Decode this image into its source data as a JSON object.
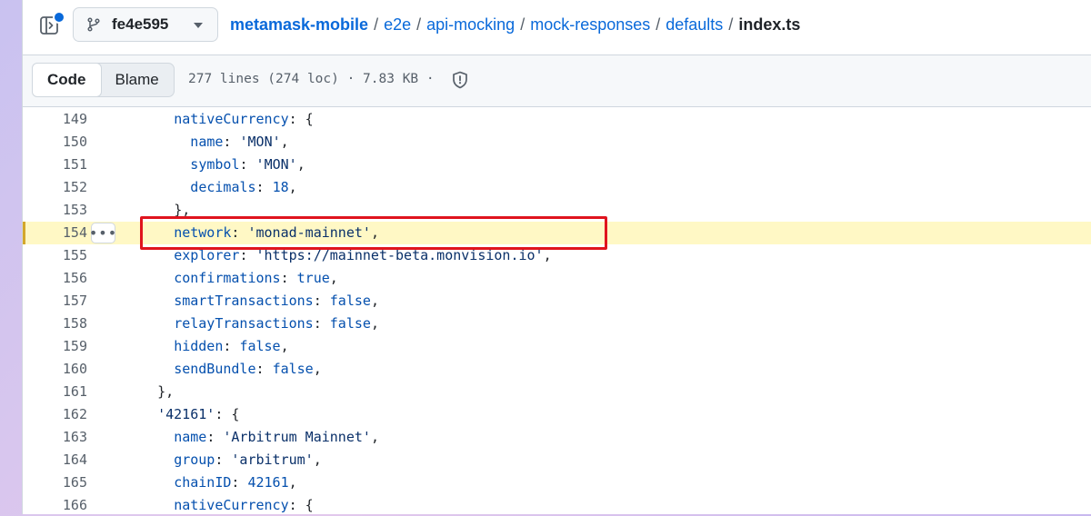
{
  "header": {
    "branch": "fe4e595",
    "breadcrumb": {
      "repo": "metamask-mobile",
      "parts": [
        "e2e",
        "api-mocking",
        "mock-responses",
        "defaults"
      ],
      "separator": "/",
      "file": "index.ts"
    }
  },
  "filebar": {
    "tabs": [
      {
        "label": "Code",
        "active": true
      },
      {
        "label": "Blame",
        "active": false
      }
    ],
    "info": "277 lines (274 loc) · 7.83 KB ·"
  },
  "code": {
    "highlighted_line": 154,
    "more_label": "•••",
    "lines": [
      {
        "num": "149",
        "indent": 2,
        "key": "nativeCurrency",
        "rest": ": {"
      },
      {
        "num": "150",
        "indent": 3,
        "key": "name",
        "rest": ": ",
        "str": "'MON'",
        "tail": ","
      },
      {
        "num": "151",
        "indent": 3,
        "key": "symbol",
        "rest": ": ",
        "str": "'MON'",
        "tail": ","
      },
      {
        "num": "152",
        "indent": 3,
        "key": "decimals",
        "rest": ": ",
        "num_val": "18",
        "tail": ","
      },
      {
        "num": "153",
        "indent": 2,
        "plain": "},"
      },
      {
        "num": "154",
        "indent": 2,
        "key": "network",
        "rest": ": ",
        "str": "'monad-mainnet'",
        "tail": ","
      },
      {
        "num": "155",
        "indent": 2,
        "key": "explorer",
        "rest": ": ",
        "str": "'https://mainnet-beta.monvision.io'",
        "tail": ","
      },
      {
        "num": "156",
        "indent": 2,
        "key": "confirmations",
        "rest": ": ",
        "kw": "true",
        "tail": ","
      },
      {
        "num": "157",
        "indent": 2,
        "key": "smartTransactions",
        "rest": ": ",
        "kw": "false",
        "tail": ","
      },
      {
        "num": "158",
        "indent": 2,
        "key": "relayTransactions",
        "rest": ": ",
        "kw": "false",
        "tail": ","
      },
      {
        "num": "159",
        "indent": 2,
        "key": "hidden",
        "rest": ": ",
        "kw": "false",
        "tail": ","
      },
      {
        "num": "160",
        "indent": 2,
        "key": "sendBundle",
        "rest": ": ",
        "kw": "false",
        "tail": ","
      },
      {
        "num": "161",
        "indent": 1,
        "plain": "},"
      },
      {
        "num": "162",
        "indent": 1,
        "strkey": "'42161'",
        "rest": ": {"
      },
      {
        "num": "163",
        "indent": 2,
        "key": "name",
        "rest": ": ",
        "str": "'Arbitrum Mainnet'",
        "tail": ","
      },
      {
        "num": "164",
        "indent": 2,
        "key": "group",
        "rest": ": ",
        "str": "'arbitrum'",
        "tail": ","
      },
      {
        "num": "165",
        "indent": 2,
        "key": "chainID",
        "rest": ": ",
        "num_val": "42161",
        "tail": ","
      },
      {
        "num": "166",
        "indent": 2,
        "key": "nativeCurrency",
        "rest": ": {"
      }
    ]
  },
  "colors": {
    "link": "#0969da",
    "highlight_bg": "#fff8c5",
    "annotation_box": "#e0141e"
  },
  "icons": [
    "sidebar-toggle-icon",
    "git-branch-icon",
    "chevron-down-icon",
    "shield-icon",
    "kebab-icon"
  ]
}
